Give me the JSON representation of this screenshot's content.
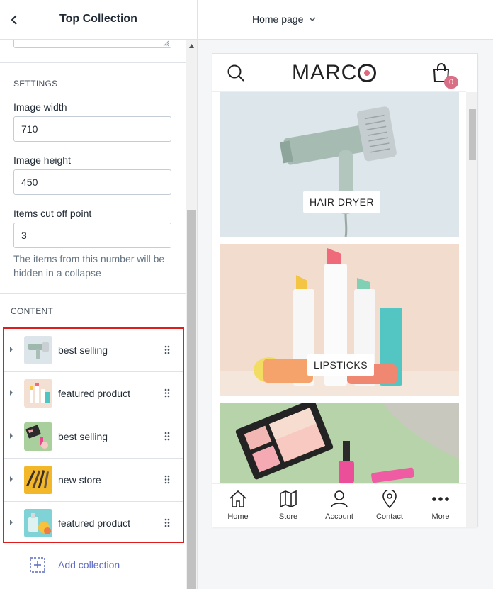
{
  "header": {
    "title": "Top Collection"
  },
  "settings": {
    "heading": "SETTINGS",
    "image_width_label": "Image width",
    "image_width_value": "710",
    "image_height_label": "Image height",
    "image_height_value": "450",
    "cutoff_label": "Items cut off point",
    "cutoff_value": "3",
    "cutoff_help": "The items from this number will be hidden in a collapse"
  },
  "content": {
    "heading": "CONTENT",
    "items": [
      {
        "label": "best selling"
      },
      {
        "label": "featured product"
      },
      {
        "label": "best selling"
      },
      {
        "label": "new store"
      },
      {
        "label": "featured product"
      }
    ],
    "add_label": "Add collection"
  },
  "topbar": {
    "page_select": "Home page"
  },
  "preview": {
    "logo_left": "MARC",
    "cart_count": "0",
    "banners": [
      {
        "label": "HAIR DRYER"
      },
      {
        "label": "LIPSTICKS"
      }
    ],
    "nav": [
      {
        "label": "Home",
        "icon": "home-icon"
      },
      {
        "label": "Store",
        "icon": "map-icon"
      },
      {
        "label": "Account",
        "icon": "user-icon"
      },
      {
        "label": "Contact",
        "icon": "location-pin-icon"
      },
      {
        "label": "More",
        "icon": "more-dots-icon"
      }
    ]
  },
  "colors": {
    "accent": "#5c6ac4",
    "highlight_border": "#e01d1d",
    "badge": "#d86f86",
    "logo_dot": "#e06a7a"
  }
}
